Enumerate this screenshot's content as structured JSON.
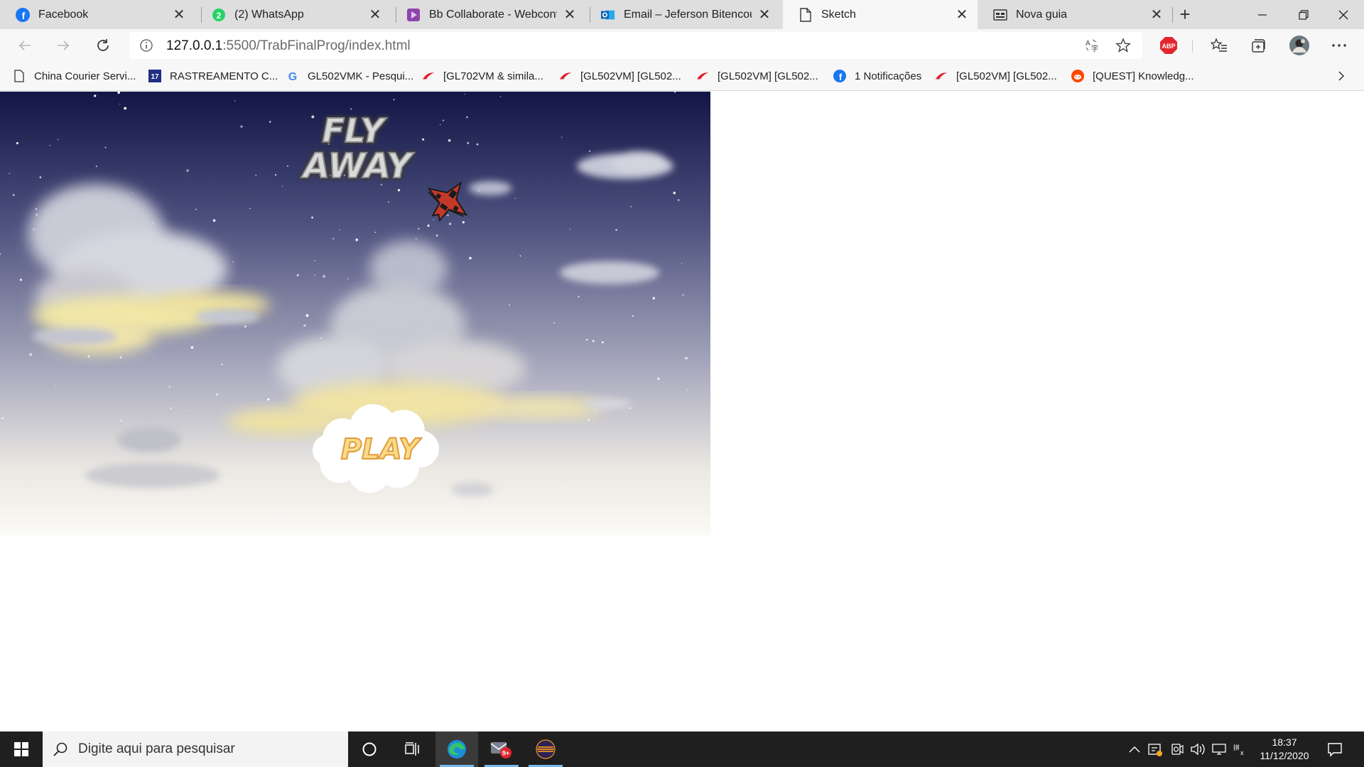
{
  "browser": {
    "tabs": [
      {
        "title": "Facebook",
        "icon": "facebook-icon",
        "active": false
      },
      {
        "title": "(2) WhatsApp",
        "icon": "whatsapp-icon",
        "active": false
      },
      {
        "title": "Bb Collaborate - Webconferê",
        "icon": "collaborate-icon",
        "active": false
      },
      {
        "title": "Email – Jeferson Bitencourt -",
        "icon": "outlook-icon",
        "active": false
      },
      {
        "title": "Sketch",
        "icon": "page-icon",
        "active": true
      },
      {
        "title": "Nova guia",
        "icon": "new-tab-page-icon",
        "active": false
      }
    ],
    "url": {
      "host": "127.0.0.1",
      "path": ":5500/TrabFinalProg/index.html"
    },
    "bookmarks": [
      {
        "label": "China Courier Servi...",
        "icon": "page-icon"
      },
      {
        "label": "RASTREAMENTO C...",
        "icon": "17track-icon"
      },
      {
        "label": "GL502VMK - Pesqui...",
        "icon": "google-icon"
      },
      {
        "label": "[GL702VM & simila...",
        "icon": "rog-icon"
      },
      {
        "label": "[GL502VM] [GL502...",
        "icon": "rog-icon"
      },
      {
        "label": "[GL502VM] [GL502...",
        "icon": "rog-icon"
      },
      {
        "label": "1 Notificações",
        "icon": "facebook-icon"
      },
      {
        "label": "[GL502VM] [GL502...",
        "icon": "rog-icon"
      },
      {
        "label": "[QUEST] Knowledg...",
        "icon": "reddit-icon"
      }
    ],
    "extension_abp": "ABP"
  },
  "game": {
    "title_line1": "FLY",
    "title_line2": "AWAY",
    "play_label": "PLAY"
  },
  "taskbar": {
    "search_placeholder": "Digite aqui para pesquisar",
    "mail_badge": "9+",
    "time": "18:37",
    "date": "11/12/2020"
  }
}
